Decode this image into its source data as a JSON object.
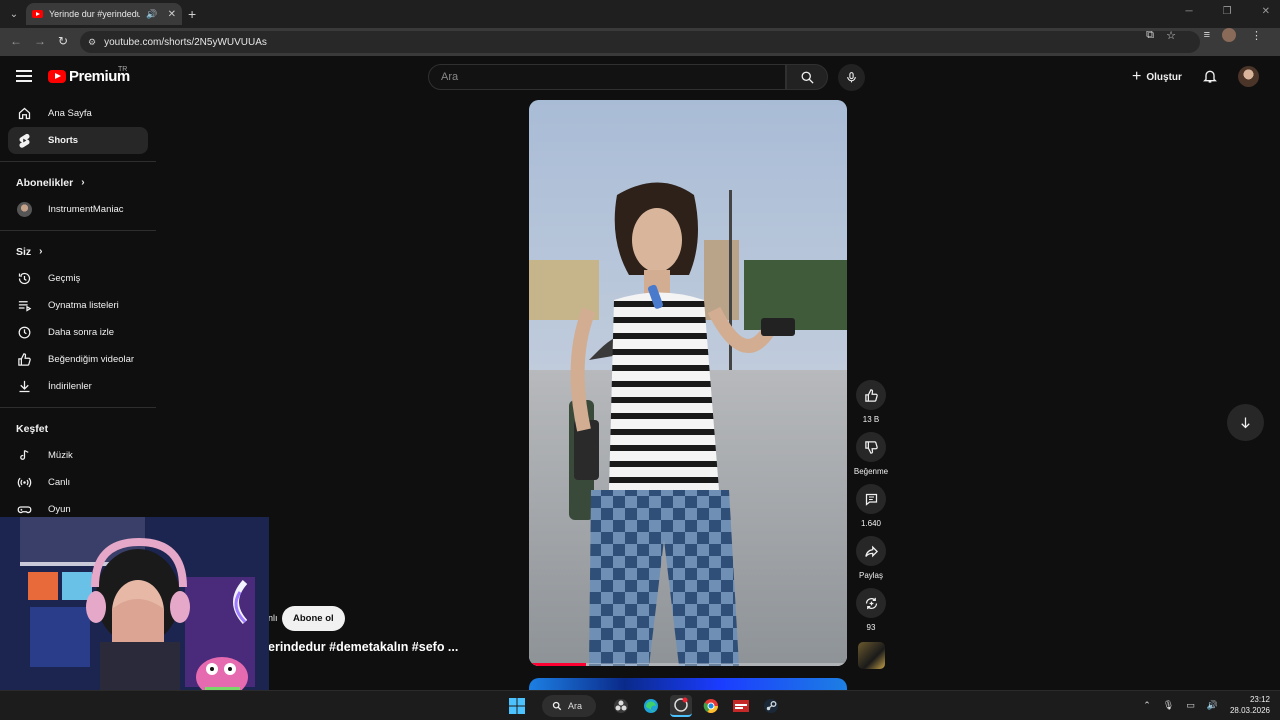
{
  "browser": {
    "tab_title": "Yerinde dur #yerindedur #d",
    "url": "youtube.com/shorts/2N5yWUVUUAs"
  },
  "header": {
    "logo_text": "Premium",
    "logo_region": "TR",
    "search_placeholder": "Ara",
    "create_label": "Oluştur"
  },
  "sidebar": {
    "top": [
      {
        "label": "Ana Sayfa",
        "icon": "home-icon"
      },
      {
        "label": "Shorts",
        "icon": "shorts-icon"
      }
    ],
    "subscriptions_heading": "Abonelikler",
    "subscriptions": [
      {
        "label": "InstrumentManiac"
      }
    ],
    "you_heading": "Siz",
    "you": [
      {
        "label": "Geçmiş",
        "icon": "history-icon"
      },
      {
        "label": "Oynatma listeleri",
        "icon": "playlists-icon"
      },
      {
        "label": "Daha sonra izle",
        "icon": "watch-later-icon"
      },
      {
        "label": "Beğendiğim videolar",
        "icon": "liked-icon"
      },
      {
        "label": "İndirilenler",
        "icon": "downloads-icon"
      }
    ],
    "explore_heading": "Keşfet",
    "explore": [
      {
        "label": "Müzik",
        "icon": "music-icon"
      },
      {
        "label": "Canlı",
        "icon": "live-icon"
      },
      {
        "label": "Oyun",
        "icon": "gaming-icon"
      }
    ]
  },
  "short": {
    "channel_fragment": "nlı",
    "subscribe_label": "Abone ol",
    "title": "erindedur #demetakalın #sefo ...",
    "progress": 0.18
  },
  "actions": {
    "like_count": "13 B",
    "dislike_label": "Beğenme",
    "comment_count": "1.640",
    "share_label": "Paylaş",
    "remix_count": "93"
  },
  "taskbar": {
    "search_label": "Ara",
    "time": "23:12",
    "date": "28.03.2026"
  },
  "colors": {
    "accent": "#ff0000",
    "background": "#0f0f0f",
    "progress": "#ff0033"
  }
}
